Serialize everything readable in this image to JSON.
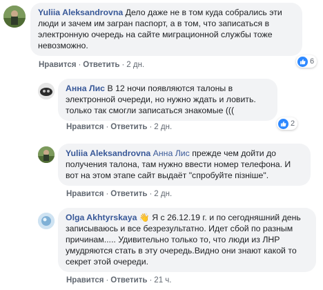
{
  "comments": [
    {
      "author": "Yuliia Aleksandrovna",
      "text": " Дело даже не в том куда собрались эти люди и зачем им загран паспорт, а в том, что записаться в электронную очередь на сайте миграционной службы тоже невозможно.",
      "like_label": "Нравится",
      "reply_label": "Ответить",
      "time": "2 дн.",
      "reactions": "6",
      "avatar_icon": "avatar-photo-icon"
    },
    {
      "author": "Анна Лис",
      "text": " В 12 ночи появляются талоны в электронной очереди, но нужно ждать и ловить. только так смогли записаться знакомые (((",
      "like_label": "Нравится",
      "reply_label": "Ответить",
      "time": "2 дн.",
      "reactions": "2",
      "avatar_icon": "avatar-photo-icon"
    },
    {
      "author": "Yuliia Aleksandrovna",
      "mention": "Анна Лис",
      "text": " прежде чем дойти до получения талона, там нужно ввести номер телефона. И вот на этом этапе сайт выдаёт \"спробуйте пізніше\".",
      "like_label": "Нравится",
      "reply_label": "Ответить",
      "time": "2 дн.",
      "avatar_icon": "avatar-photo-icon"
    },
    {
      "author": "Olga Akhtyrskaya",
      "text": " Я с 26.12.19 г. и по сегодняшний день записываюсь и все безрезультатно. Идет сбой по разным причинам..... Удивительно только то, что люди из ЛНР умудряются стать в эту очередь.Видно они знают какой то секрет этой очереди.",
      "like_label": "Нравится",
      "reply_label": "Ответить",
      "time": "21 ч.",
      "avatar_icon": "avatar-photo-icon"
    }
  ],
  "colors": {
    "link": "#385898",
    "bubble": "#f2f3f5",
    "meta": "#606770",
    "like": "#2d88ff"
  },
  "separator": "·"
}
